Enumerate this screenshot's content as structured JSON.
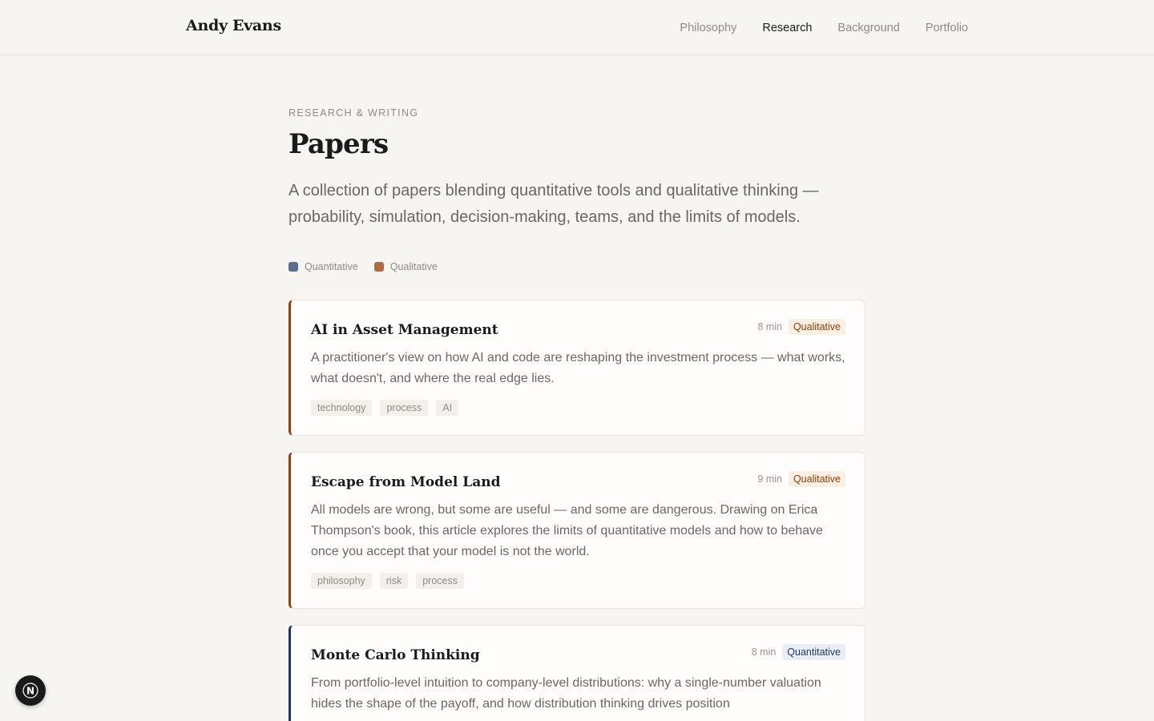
{
  "header": {
    "brand": "Andy Evans",
    "nav": [
      "Philosophy",
      "Research",
      "Background",
      "Portfolio"
    ],
    "active_nav": "Research"
  },
  "hero": {
    "eyebrow": "RESEARCH & WRITING",
    "title": "Papers",
    "lede": "A collection of papers blending quantitative tools and qualitative thinking — probability, simulation, decision-making, teams, and the limits of models."
  },
  "legend": {
    "quantitative": "Quantitative",
    "qualitative": "Qualitative",
    "colors": {
      "quantitative": "#5a6f8c",
      "qualitative": "#b06a3b"
    }
  },
  "papers": [
    {
      "title": "AI in Asset Management",
      "read_time": "8 min",
      "category": "Qualitative",
      "description": "A practitioner's view on how AI and code are reshaping the investment process — what works, what doesn't, and where the real edge lies.",
      "tags": [
        "technology",
        "process",
        "AI"
      ]
    },
    {
      "title": "Escape from Model Land",
      "read_time": "9 min",
      "category": "Qualitative",
      "description": "All models are wrong, but some are useful — and some are dangerous. Drawing on Erica Thompson's book, this article explores the limits of quantitative models and how to behave once you accept that your model is not the world.",
      "tags": [
        "philosophy",
        "risk",
        "process"
      ]
    },
    {
      "title": "Monte Carlo Thinking",
      "read_time": "8 min",
      "category": "Quantitative",
      "description": "From portfolio-level intuition to company-level distributions: why a single-number valuation hides the shape of the payoff, and how distribution thinking drives position",
      "tags": []
    }
  ],
  "dev_badge": {
    "letter": "N"
  }
}
